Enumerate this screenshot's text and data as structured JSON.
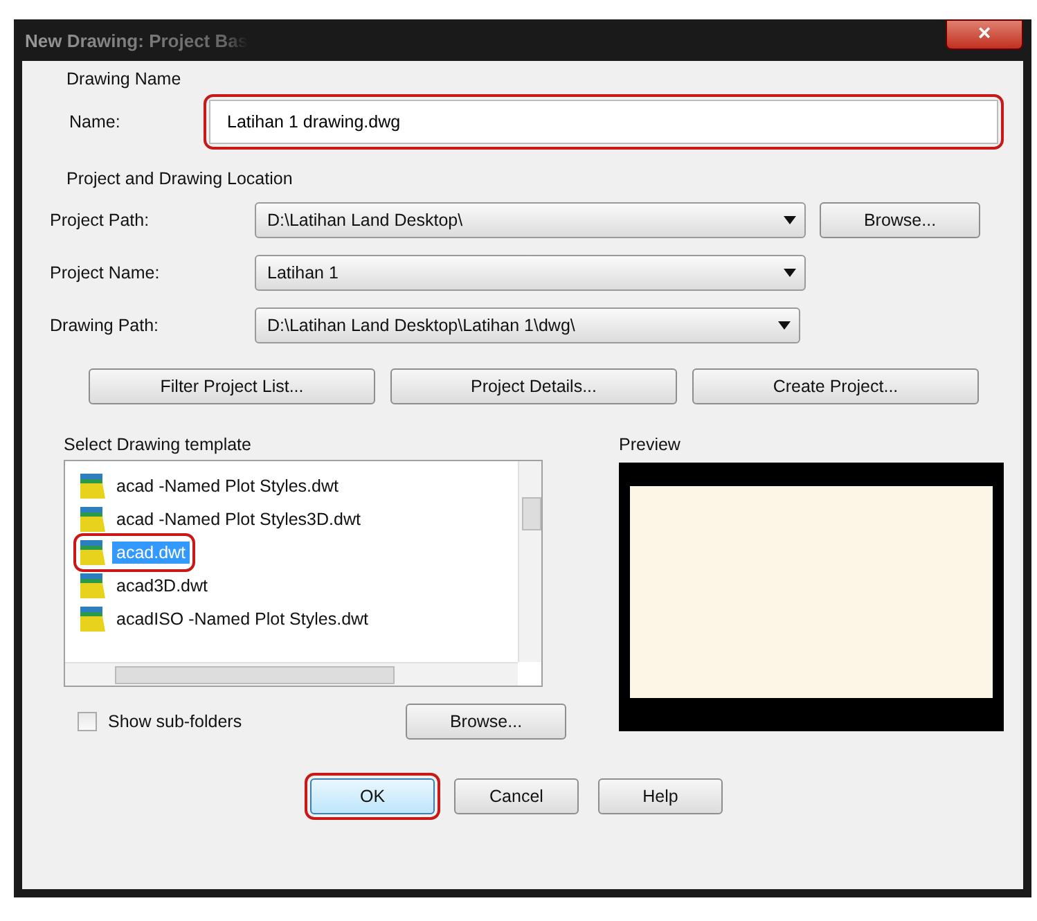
{
  "window": {
    "title": "New Drawing: Project Bas",
    "close": "×"
  },
  "drawing_name": {
    "heading": "Drawing Name",
    "label": "Name:",
    "value": "Latihan 1 drawing.dwg",
    "highlighted": true
  },
  "location": {
    "heading": "Project and Drawing Location",
    "fields": [
      {
        "label": "Project Path:",
        "value": "D:\\Latihan Land Desktop\\",
        "button": "Browse..."
      },
      {
        "label": "Project Name:",
        "value": "Latihan 1"
      },
      {
        "label": "Drawing Path:",
        "value": "D:\\Latihan Land Desktop\\Latihan 1\\dwg\\"
      }
    ],
    "buttons": [
      "Filter Project List...",
      "Project Details...",
      "Create Project..."
    ]
  },
  "templates": {
    "heading": "Select Drawing template",
    "items": [
      {
        "name": "acad -Named Plot Styles.dwt",
        "selected": false,
        "highlighted": false
      },
      {
        "name": "acad -Named Plot Styles3D.dwt",
        "selected": false,
        "highlighted": false
      },
      {
        "name": "acad.dwt",
        "selected": true,
        "highlighted": true
      },
      {
        "name": "acad3D.dwt",
        "selected": false,
        "highlighted": false
      },
      {
        "name": "acadISO -Named Plot Styles.dwt",
        "selected": false,
        "highlighted": false
      }
    ]
  },
  "show_subfolders": {
    "label": "Show sub-folders",
    "checked": false
  },
  "browse_button": "Browse...",
  "preview": {
    "heading": "Preview"
  },
  "buttons": [
    {
      "label": "OK",
      "default": true,
      "highlighted": true
    },
    {
      "label": "Cancel",
      "default": false,
      "highlighted": false
    },
    {
      "label": "Help",
      "default": false,
      "highlighted": false
    }
  ]
}
